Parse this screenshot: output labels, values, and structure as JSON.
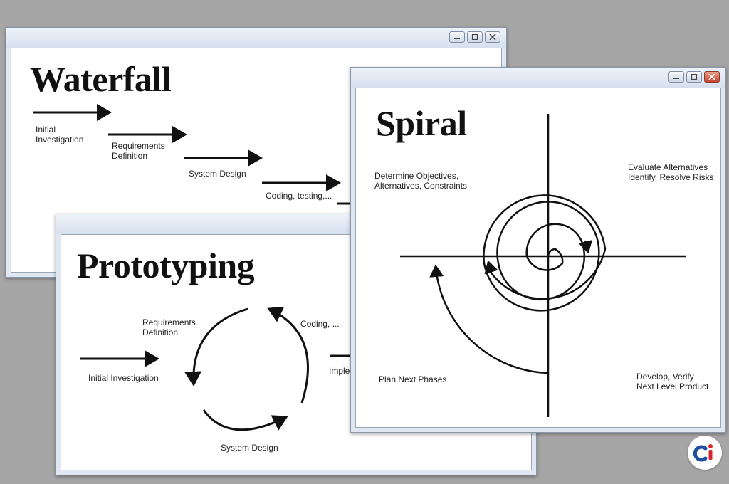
{
  "waterfall": {
    "title": "Waterfall",
    "steps": [
      "Initial\nInvestigation",
      "Requirements\nDefinition",
      "System Design",
      "Coding, testing,..."
    ]
  },
  "prototyping": {
    "title": "Prototyping",
    "labels": {
      "initial": "Initial Investigation",
      "requirements": "Requirements\nDefinition",
      "coding": "Coding, ...",
      "system_design": "System Design",
      "implementation": "Imple"
    }
  },
  "spiral": {
    "title": "Spiral",
    "quadrants": {
      "top_left": "Determine Objectives,\nAlternatives, Constraints",
      "top_right": "Evaluate Alternatives\nIdentify, Resolve Risks",
      "bottom_left": "Plan Next Phases",
      "bottom_right": "Develop, Verify\nNext Level Product"
    }
  },
  "logo": {
    "text": "ci",
    "colors": {
      "c": "#1f4fa3",
      "i": "#d7262c"
    }
  },
  "colors": {
    "desktop": "#a6a6a6",
    "frame": "#dfe7f2",
    "ink": "#111111"
  }
}
